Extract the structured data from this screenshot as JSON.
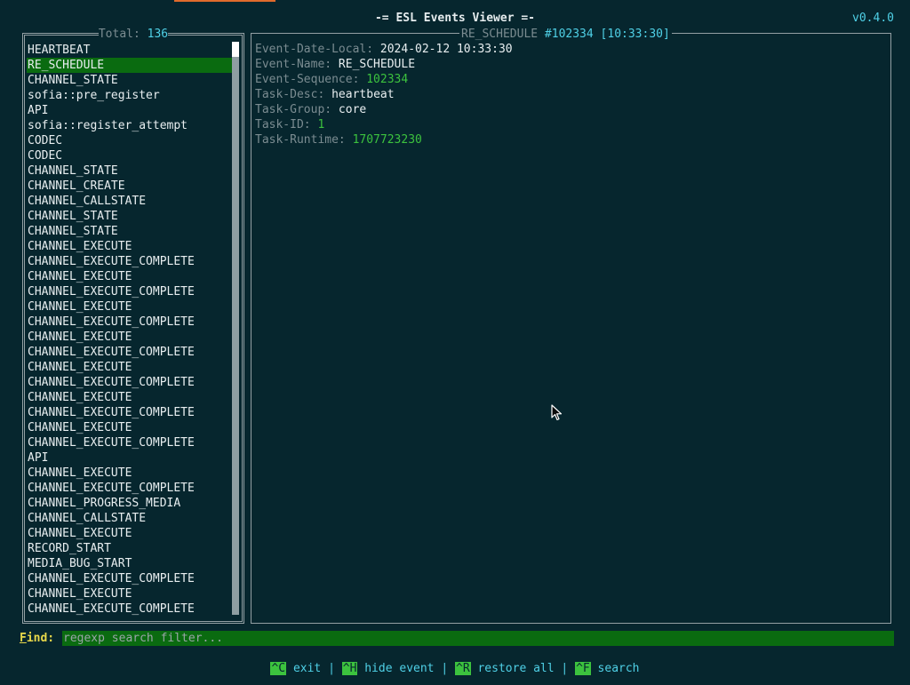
{
  "app": {
    "title": "-= ESL Events Viewer =-",
    "version": "v0.4.0"
  },
  "event_list": {
    "total_label": "Total:",
    "total_count": "136",
    "selected_index": 1,
    "items": [
      "HEARTBEAT",
      "RE_SCHEDULE",
      "CHANNEL_STATE",
      "sofia::pre_register",
      "API",
      "sofia::register_attempt",
      "CODEC",
      "CODEC",
      "CHANNEL_STATE",
      "CHANNEL_CREATE",
      "CHANNEL_CALLSTATE",
      "CHANNEL_STATE",
      "CHANNEL_STATE",
      "CHANNEL_EXECUTE",
      "CHANNEL_EXECUTE_COMPLETE",
      "CHANNEL_EXECUTE",
      "CHANNEL_EXECUTE_COMPLETE",
      "CHANNEL_EXECUTE",
      "CHANNEL_EXECUTE_COMPLETE",
      "CHANNEL_EXECUTE",
      "CHANNEL_EXECUTE_COMPLETE",
      "CHANNEL_EXECUTE",
      "CHANNEL_EXECUTE_COMPLETE",
      "CHANNEL_EXECUTE",
      "CHANNEL_EXECUTE_COMPLETE",
      "CHANNEL_EXECUTE",
      "CHANNEL_EXECUTE_COMPLETE",
      "API",
      "CHANNEL_EXECUTE",
      "CHANNEL_EXECUTE_COMPLETE",
      "CHANNEL_PROGRESS_MEDIA",
      "CHANNEL_CALLSTATE",
      "CHANNEL_EXECUTE",
      "RECORD_START",
      "MEDIA_BUG_START",
      "CHANNEL_EXECUTE_COMPLETE",
      "CHANNEL_EXECUTE",
      "CHANNEL_EXECUTE_COMPLETE"
    ]
  },
  "detail": {
    "event_name": "RE_SCHEDULE",
    "sequence": "#102334",
    "time": "[10:33:30]",
    "fields": [
      {
        "key": "Event-Date-Local:",
        "value": "2024-02-12 10:33:30",
        "color": "white"
      },
      {
        "key": "Event-Name:",
        "value": "RE_SCHEDULE",
        "color": "white"
      },
      {
        "key": "Event-Sequence:",
        "value": "102334",
        "color": "green"
      },
      {
        "key": "Task-Desc:",
        "value": "heartbeat",
        "color": "white"
      },
      {
        "key": "Task-Group:",
        "value": "core",
        "color": "white"
      },
      {
        "key": "Task-ID:",
        "value": "1",
        "color": "green"
      },
      {
        "key": "Task-Runtime:",
        "value": "1707723230",
        "color": "green"
      }
    ]
  },
  "find": {
    "label_first": "F",
    "label_rest": "ind:",
    "placeholder": "regexp search filter...",
    "value": ""
  },
  "footer": {
    "shortcuts": [
      {
        "key": "^C",
        "label": "exit"
      },
      {
        "key": "^H",
        "label": "hide event"
      },
      {
        "key": "^R",
        "label": "restore all"
      },
      {
        "key": "^F",
        "label": "search"
      }
    ],
    "separator": "|"
  },
  "colors": {
    "background": "#06262e",
    "selection": "#0a6b10",
    "accent_cyan": "#4fd0e6",
    "accent_green": "#3cc23e",
    "find_label": "#e8d84a",
    "muted": "#7b8c91"
  }
}
